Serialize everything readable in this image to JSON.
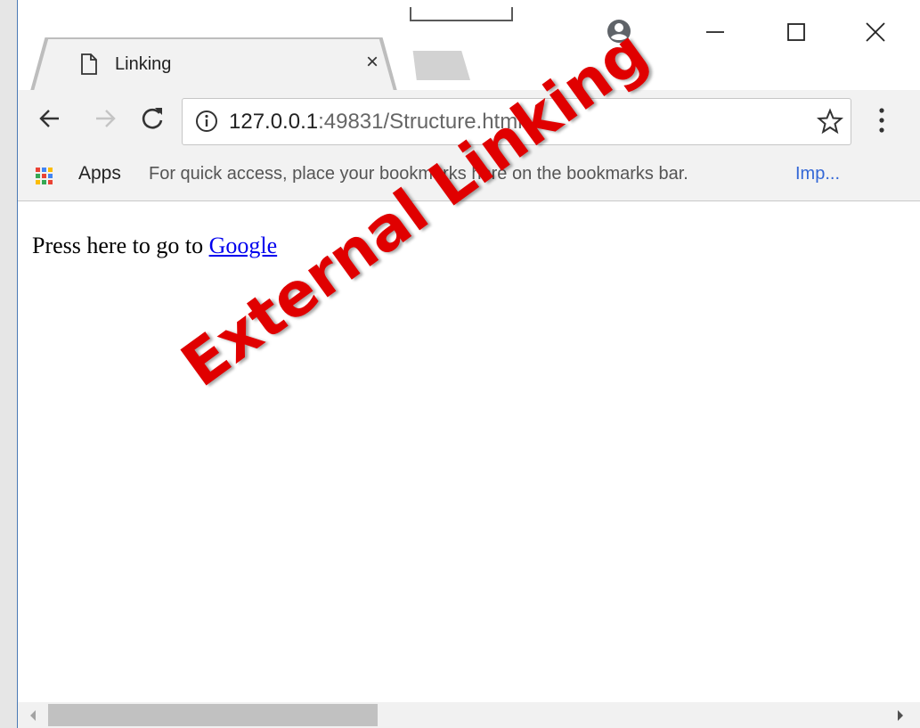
{
  "tab": {
    "title": "Linking",
    "close": "×"
  },
  "toolbar": {
    "url_host": "127.0.0.1",
    "url_port_path": ":49831/Structure.html"
  },
  "bookmarks": {
    "apps_label": "Apps",
    "hint": "For quick access, place your bookmarks here on the bookmarks bar.",
    "import_link": "Imp..."
  },
  "page": {
    "text": "Press here to go to ",
    "link": "Google",
    "overlay": "External Linking"
  },
  "colors": {
    "link": "#0000ee",
    "overlay": "#e00000",
    "frame": "#2b78c2"
  }
}
